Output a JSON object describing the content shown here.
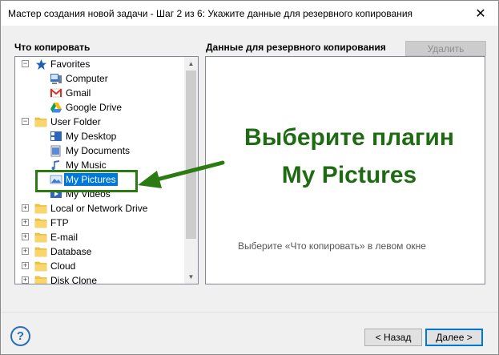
{
  "window": {
    "title": "Мастер создания новой задачи - Шаг 2 из 6: Укажите данные для резервного копирования",
    "close_glyph": "✕"
  },
  "left": {
    "label": "Что копировать"
  },
  "tree": {
    "items": [
      {
        "label": "Favorites",
        "expander": "⊟",
        "icon": "star-icon",
        "level": 0
      },
      {
        "label": "Computer",
        "icon": "computer-icon",
        "level": 1
      },
      {
        "label": "Gmail",
        "icon": "gmail-icon",
        "level": 1
      },
      {
        "label": "Google Drive",
        "icon": "google-drive-icon",
        "level": 1
      },
      {
        "label": "User Folder",
        "expander": "⊟",
        "icon": "folder-icon",
        "level": 0
      },
      {
        "label": "My Desktop",
        "icon": "desktop-icon",
        "level": 1
      },
      {
        "label": "My Documents",
        "icon": "documents-icon",
        "level": 1
      },
      {
        "label": "My Music",
        "icon": "music-icon",
        "level": 1
      },
      {
        "label": "My Pictures",
        "icon": "pictures-icon",
        "level": 1,
        "selected": true
      },
      {
        "label": "My Videos",
        "icon": "videos-icon",
        "level": 1
      },
      {
        "label": "Local or Network Drive",
        "expander": "⊞",
        "icon": "folder-icon",
        "level": 0
      },
      {
        "label": "FTP",
        "expander": "⊞",
        "icon": "folder-icon",
        "level": 0
      },
      {
        "label": "E-mail",
        "expander": "⊞",
        "icon": "folder-icon",
        "level": 0
      },
      {
        "label": "Database",
        "expander": "⊞",
        "icon": "folder-icon",
        "level": 0
      },
      {
        "label": "Cloud",
        "expander": "⊞",
        "icon": "folder-icon",
        "level": 0
      },
      {
        "label": "Disk Clone",
        "expander": "⊞",
        "icon": "folder-icon",
        "level": 0
      }
    ]
  },
  "right": {
    "label": "Данные для резервного копирования",
    "delete_label": "Удалить",
    "hint": "Выберите «Что копировать» в левом окне"
  },
  "annotation": {
    "line1": "Выберите плагин",
    "line2": "My Pictures",
    "color": "#1f6b14"
  },
  "footer": {
    "help_glyph": "?",
    "back_label": "< Назад",
    "next_label": "Далее >"
  },
  "colors": {
    "selection": "#0078d7",
    "folder": "#f4c542",
    "highlight": "#2b7a12"
  }
}
